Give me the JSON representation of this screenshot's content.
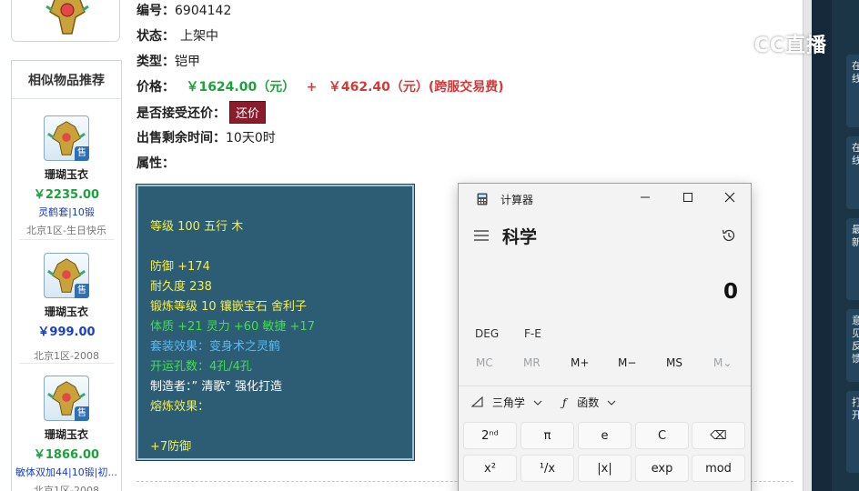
{
  "item": {
    "id_label": "编号：",
    "id_value": "6904142",
    "status_label": "状态：",
    "status_value": "上架中",
    "type_label": "类型：",
    "type_value": "铠甲",
    "price_label": "价格：",
    "price_main": "￥1624.00（元）",
    "price_plus": "+",
    "price_fee": "￥462.40（元）(跨服交易费)",
    "bargain_label": "是否接受还价：",
    "bargain_button": "还价",
    "time_label": "出售剩余时间：",
    "time_value": "10天0时",
    "attr_label": "属性："
  },
  "attributes": {
    "line1": "等级 100 五行 木",
    "line2": "防御 +174",
    "line3": "耐久度 238",
    "line4": "锻炼等级 10 镶嵌宝石 舍利子",
    "line5": "体质 +21 灵力 +60 敏捷 +17",
    "line6": "套装效果：变身术之灵鹤",
    "line7": "开运孔数：4孔/4孔",
    "line8": "制造者：” 清歌° 强化打造",
    "line9": "熔炼效果：",
    "line10": "+7防御"
  },
  "similar": {
    "title": "相似物品推荐",
    "sale_tag": "售",
    "items": [
      {
        "name": "珊瑚玉衣",
        "price": "￥2235.00",
        "extra": "灵鹤套|10锻",
        "server": "北京1区-生日快乐"
      },
      {
        "name": "珊瑚玉衣",
        "price": "￥999.00",
        "extra": "",
        "server": "北京1区-2008"
      },
      {
        "name": "珊瑚玉衣",
        "price": "￥1866.00",
        "extra": "敏体双加44|10锻|初...",
        "server": "北京1区-2008"
      }
    ]
  },
  "watermark": {
    "text": "CC直播"
  },
  "calculator": {
    "title": "计算器",
    "mode": "科学",
    "display": "0",
    "deg": "DEG",
    "fe": "F-E",
    "memory": [
      "MC",
      "MR",
      "M+",
      "M−",
      "MS",
      "M⌄"
    ],
    "trig": "三角学",
    "func": "函数",
    "keys_row1": [
      "2ⁿᵈ",
      "π",
      "e",
      "C",
      "⌫"
    ],
    "keys_row2": [
      "x²",
      "¹/x",
      "|x|",
      "exp",
      "mod"
    ]
  },
  "side_panel": {
    "cards": [
      "在线",
      "在线",
      "最新",
      "意见反馈",
      "打开"
    ]
  },
  "colors": {
    "attr_bg": "#2c5d74",
    "price_green": "#1aa33a",
    "price_red": "#d23a3a",
    "bargain_bg": "#8b1c2c"
  }
}
